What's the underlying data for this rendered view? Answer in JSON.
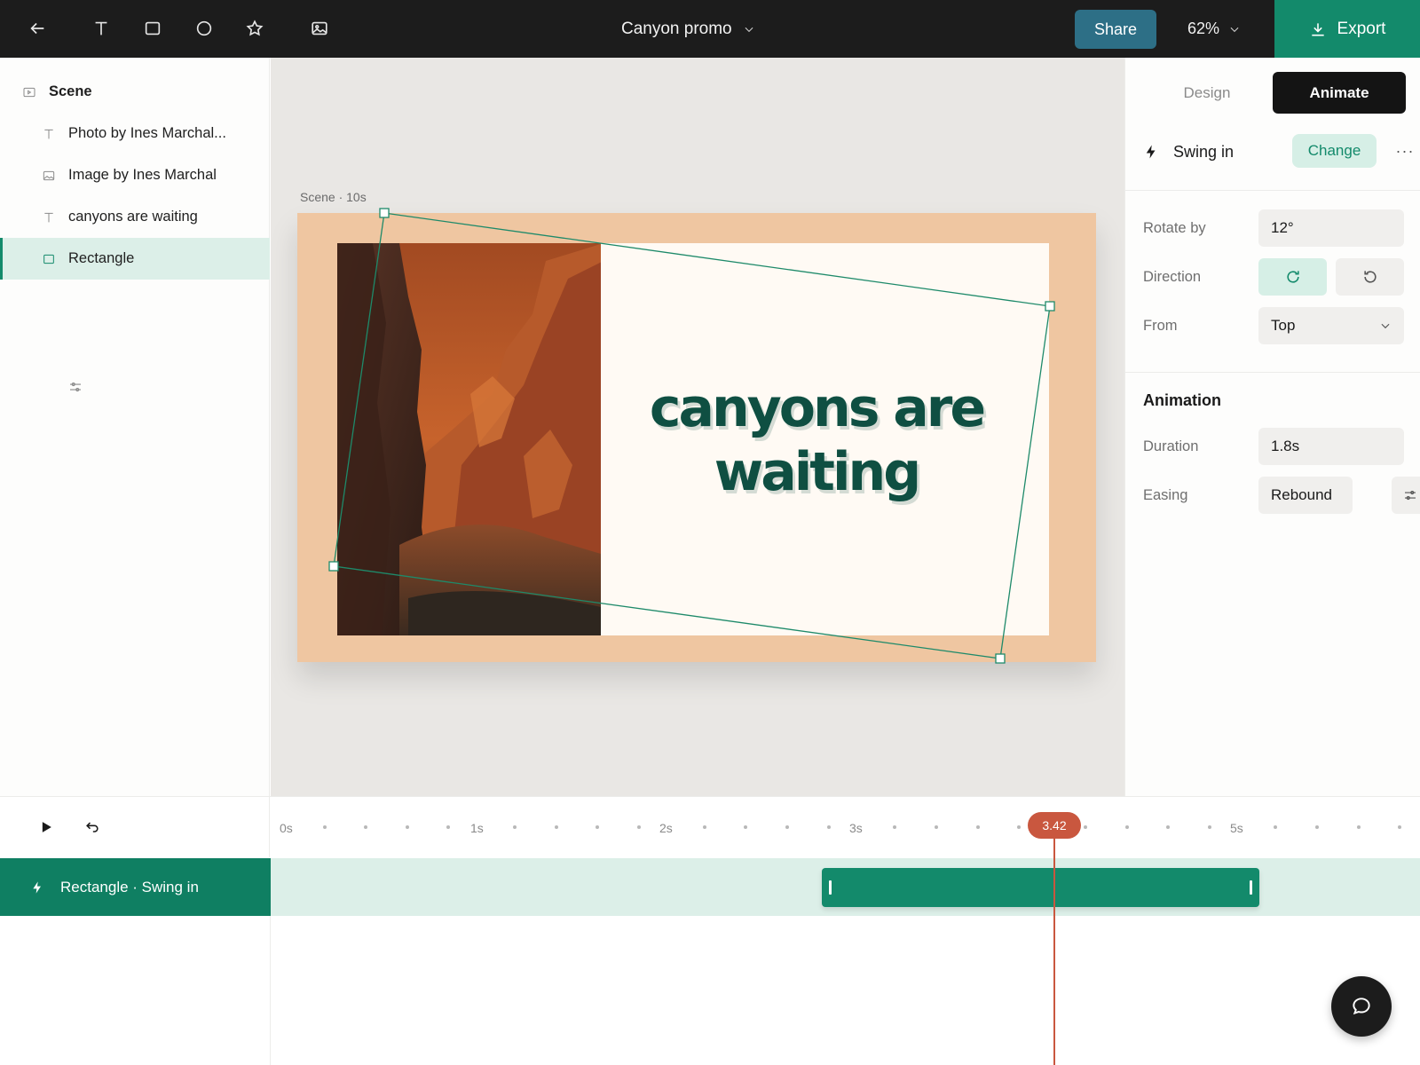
{
  "topbar": {
    "title": "Canyon promo",
    "share_label": "Share",
    "zoom": "62%",
    "export_label": "Export",
    "icons": [
      "back-arrow-icon",
      "text-tool-icon",
      "rectangle-tool-icon",
      "ellipse-tool-icon",
      "star-tool-icon",
      "image-tool-icon"
    ]
  },
  "layers": [
    {
      "label": "Scene",
      "icon": "scene-icon"
    },
    {
      "label": "Photo by Ines Marchal...",
      "icon": "text-icon"
    },
    {
      "label": "Image by Ines Marchal",
      "icon": "image-icon"
    },
    {
      "label": "canyons are waiting",
      "icon": "text-icon"
    },
    {
      "label": "Rectangle",
      "icon": "rectangle-icon",
      "selected": true
    }
  ],
  "canvas": {
    "scene_label": "Scene · 10s",
    "headline": "canyons are waiting"
  },
  "props": {
    "tabs": {
      "design": "Design",
      "animate": "Animate",
      "active": "Animate"
    },
    "animation_name": "Swing in",
    "change_label": "Change",
    "more_label": "···",
    "rotate_label": "Rotate by",
    "rotate_value": "12°",
    "direction_label": "Direction",
    "direction_selected": "clockwise",
    "from_label": "From",
    "from_value": "Top",
    "section_title": "Animation",
    "duration_label": "Duration",
    "duration_value": "1.8s",
    "easing_label": "Easing",
    "easing_value": "Rebound"
  },
  "timeline": {
    "ticks": [
      "0s",
      "1s",
      "2s",
      "3s",
      "5s"
    ],
    "playhead": "3.42",
    "track_label": "Rectangle · Swing in"
  },
  "colors": {
    "accent": "#138a6b",
    "share": "#2d6f86",
    "playhead": "#c9573f",
    "scene_bg": "#efc6a1",
    "headline": "#0f4f42"
  }
}
